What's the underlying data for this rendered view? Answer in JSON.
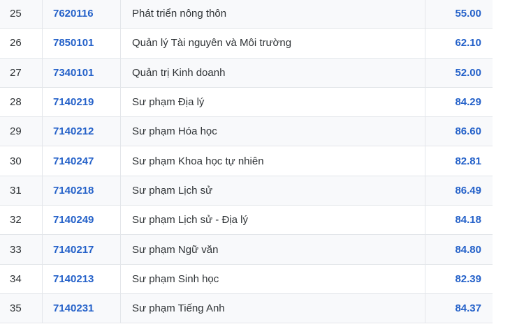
{
  "table": {
    "rows": [
      {
        "stt": "25",
        "code": "7620116",
        "name": "Phát triển nông thôn",
        "score": "55.00"
      },
      {
        "stt": "26",
        "code": "7850101",
        "name": "Quản lý Tài nguyên và Môi trường",
        "score": "62.10"
      },
      {
        "stt": "27",
        "code": "7340101",
        "name": "Quản trị Kinh doanh",
        "score": "52.00"
      },
      {
        "stt": "28",
        "code": "7140219",
        "name": "Sư phạm Địa lý",
        "score": "84.29"
      },
      {
        "stt": "29",
        "code": "7140212",
        "name": "Sư phạm Hóa học",
        "score": "86.60"
      },
      {
        "stt": "30",
        "code": "7140247",
        "name": "Sư phạm Khoa học tự nhiên",
        "score": "82.81"
      },
      {
        "stt": "31",
        "code": "7140218",
        "name": "Sư phạm Lịch sử",
        "score": "86.49"
      },
      {
        "stt": "32",
        "code": "7140249",
        "name": "Sư phạm Lịch sử - Địa lý",
        "score": "84.18"
      },
      {
        "stt": "33",
        "code": "7140217",
        "name": "Sư phạm Ngữ văn",
        "score": "84.80"
      },
      {
        "stt": "34",
        "code": "7140213",
        "name": "Sư phạm Sinh học",
        "score": "82.39"
      },
      {
        "stt": "35",
        "code": "7140231",
        "name": "Sư phạm Tiếng Anh",
        "score": "84.37"
      }
    ]
  },
  "colors": {
    "accent": "#2461c9",
    "text": "#2f3336",
    "row_alt": "#f8f9fb",
    "border": "#e3e6ea"
  }
}
